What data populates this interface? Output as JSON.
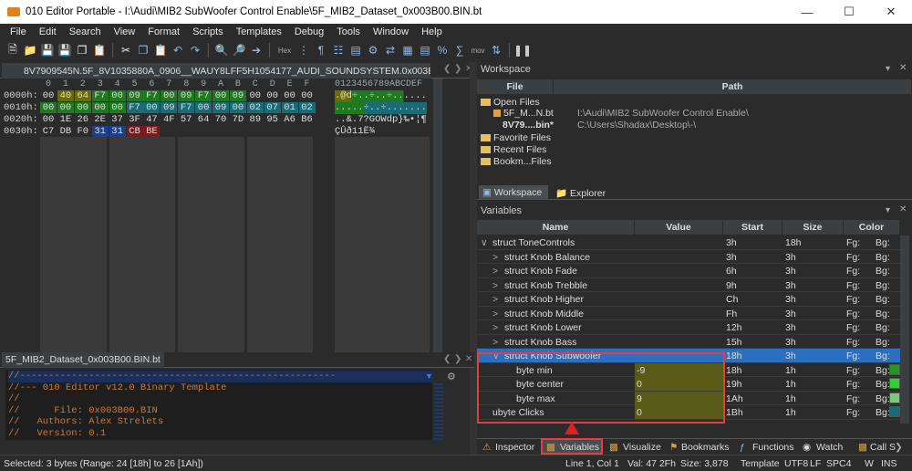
{
  "window": {
    "title": "010 Editor Portable - I:\\Audi\\MIB2 SubWoofer Control Enable\\5F_MIB2_Dataset_0x003B00.BIN.bt"
  },
  "menu": [
    "File",
    "Edit",
    "Search",
    "View",
    "Format",
    "Scripts",
    "Templates",
    "Debug",
    "Tools",
    "Window",
    "Help"
  ],
  "toolbar": {
    "hex_label": "Hex",
    "mov_label": "mov"
  },
  "hex_tab": {
    "label": "8V7909545N.5F_8V1035880A_0906__WAUY8LFF5H1054177_AUDI_SOUNDSYSTEM.0x003B00.bin*"
  },
  "hex": {
    "header_cols": [
      "0",
      "1",
      "2",
      "3",
      "4",
      "5",
      "6",
      "7",
      "8",
      "9",
      "A",
      "B",
      "C",
      "D",
      "E",
      "F"
    ],
    "ascii_header": "0123456789ABCDEF",
    "rows": [
      {
        "addr": "0000h:",
        "bytes": [
          "00",
          "40",
          "64",
          "F7",
          "00",
          "09",
          "F7",
          "00",
          "09",
          "F7",
          "00",
          "09",
          "00",
          "00",
          "00",
          "00"
        ],
        "ascii": ".@d÷..÷..÷......"
      },
      {
        "addr": "0010h:",
        "bytes": [
          "00",
          "00",
          "00",
          "00",
          "00",
          "F7",
          "00",
          "09",
          "F7",
          "00",
          "09",
          "00",
          "02",
          "07",
          "01",
          "02"
        ],
        "ascii": ".....÷..÷......."
      },
      {
        "addr": "0020h:",
        "bytes": [
          "00",
          "1E",
          "26",
          "2E",
          "37",
          "3F",
          "47",
          "4F",
          "57",
          "64",
          "70",
          "7D",
          "89",
          "95",
          "A6",
          "B6"
        ],
        "ascii": "..&.7?GOWdp}‰•¦¶"
      },
      {
        "addr": "0030h:",
        "bytes": [
          "C7",
          "DB",
          "F0",
          "31",
          "31",
          "CB",
          "BE"
        ],
        "ascii": "ÇÛð11Ë¾"
      }
    ],
    "colors": {
      "olive": "#6b6b00",
      "green": "#1f7a1f",
      "teal": "#1a6b78",
      "blue": "#1c3f8c",
      "red": "#7a1a1a"
    }
  },
  "code_tab": {
    "label": "5F_MIB2_Dataset_0x003B00.BIN.bt"
  },
  "code_lines": [
    "//-------------------------------------------------------",
    "//--- 010 Editor v12.0 Binary Template",
    "//",
    "//      File: 0x003B00.BIN",
    "//   Authors: Alex Strelets",
    "//   Version: 0.1"
  ],
  "workspace": {
    "title": "Workspace",
    "col_file": "File",
    "col_path": "Path",
    "open_files_label": "Open Files",
    "files": [
      {
        "name": "5F_M...N.bt",
        "path": "I:\\Audi\\MIB2 SubWoofer Control Enable\\"
      },
      {
        "name": "8V79....bin*",
        "path": "C:\\Users\\Shadax\\Desktop\\-\\"
      }
    ],
    "favorite_label": "Favorite Files",
    "recent_label": "Recent Files",
    "bookmark_label": "Bookm...Files",
    "tab_workspace": "Workspace",
    "tab_explorer": "Explorer"
  },
  "variables": {
    "title": "Variables",
    "cols": {
      "name": "Name",
      "value": "Value",
      "start": "Start",
      "size": "Size",
      "color": "Color"
    },
    "rows": [
      {
        "name": "struct ToneControls",
        "value": "",
        "start": "3h",
        "size": "18h",
        "fg": "Fg:",
        "bg": "Bg:",
        "indent": 0,
        "arrow": "∨"
      },
      {
        "name": "struct Knob Balance",
        "value": "",
        "start": "3h",
        "size": "3h",
        "fg": "Fg:",
        "bg": "Bg:",
        "indent": 1,
        "arrow": ">"
      },
      {
        "name": "struct Knob Fade",
        "value": "",
        "start": "6h",
        "size": "3h",
        "fg": "Fg:",
        "bg": "Bg:",
        "indent": 1,
        "arrow": ">"
      },
      {
        "name": "struct Knob Trebble",
        "value": "",
        "start": "9h",
        "size": "3h",
        "fg": "Fg:",
        "bg": "Bg:",
        "indent": 1,
        "arrow": ">"
      },
      {
        "name": "struct Knob Higher",
        "value": "",
        "start": "Ch",
        "size": "3h",
        "fg": "Fg:",
        "bg": "Bg:",
        "indent": 1,
        "arrow": ">"
      },
      {
        "name": "struct Knob Middle",
        "value": "",
        "start": "Fh",
        "size": "3h",
        "fg": "Fg:",
        "bg": "Bg:",
        "indent": 1,
        "arrow": ">"
      },
      {
        "name": "struct Knob Lower",
        "value": "",
        "start": "12h",
        "size": "3h",
        "fg": "Fg:",
        "bg": "Bg:",
        "indent": 1,
        "arrow": ">"
      },
      {
        "name": "struct Knob Bass",
        "value": "",
        "start": "15h",
        "size": "3h",
        "fg": "Fg:",
        "bg": "Bg:",
        "indent": 1,
        "arrow": ">"
      },
      {
        "name": "struct Knob Subwoofer",
        "value": "",
        "start": "18h",
        "size": "3h",
        "fg": "Fg:",
        "bg": "Bg:",
        "indent": 1,
        "arrow": "∨",
        "selected": true
      },
      {
        "name": "byte min",
        "value": "-9",
        "start": "18h",
        "size": "1h",
        "fg": "Fg:",
        "bg": "Bg:",
        "indent": 2,
        "arrow": "",
        "hl": true
      },
      {
        "name": "byte center",
        "value": "0",
        "start": "19h",
        "size": "1h",
        "fg": "Fg:",
        "bg": "Bg:",
        "indent": 2,
        "arrow": "",
        "hl": true
      },
      {
        "name": "byte max",
        "value": "9",
        "start": "1Ah",
        "size": "1h",
        "fg": "Fg:",
        "bg": "Bg:",
        "indent": 2,
        "arrow": "",
        "hl": true
      },
      {
        "name": "ubyte Clicks",
        "value": "0",
        "start": "1Bh",
        "size": "1h",
        "fg": "Fg:",
        "bg": "Bg:",
        "indent": 0,
        "arrow": "",
        "hl": true
      }
    ]
  },
  "bottom_tabs": [
    "Inspector",
    "Variables",
    "Visualize",
    "Bookmarks",
    "Functions",
    "Watch",
    "Call S"
  ],
  "status": {
    "selected": "Selected: 3 bytes (Range: 24 [18h] to 26 [1Ah])",
    "line": "Line 1, Col 1",
    "val": "Val: 47 2Fh",
    "size": "Size: 3,878",
    "template": "Template",
    "encoding": "UTF8",
    "eol": "LF",
    "indent": "SPC4",
    "w": "W",
    "ins": "INS"
  }
}
